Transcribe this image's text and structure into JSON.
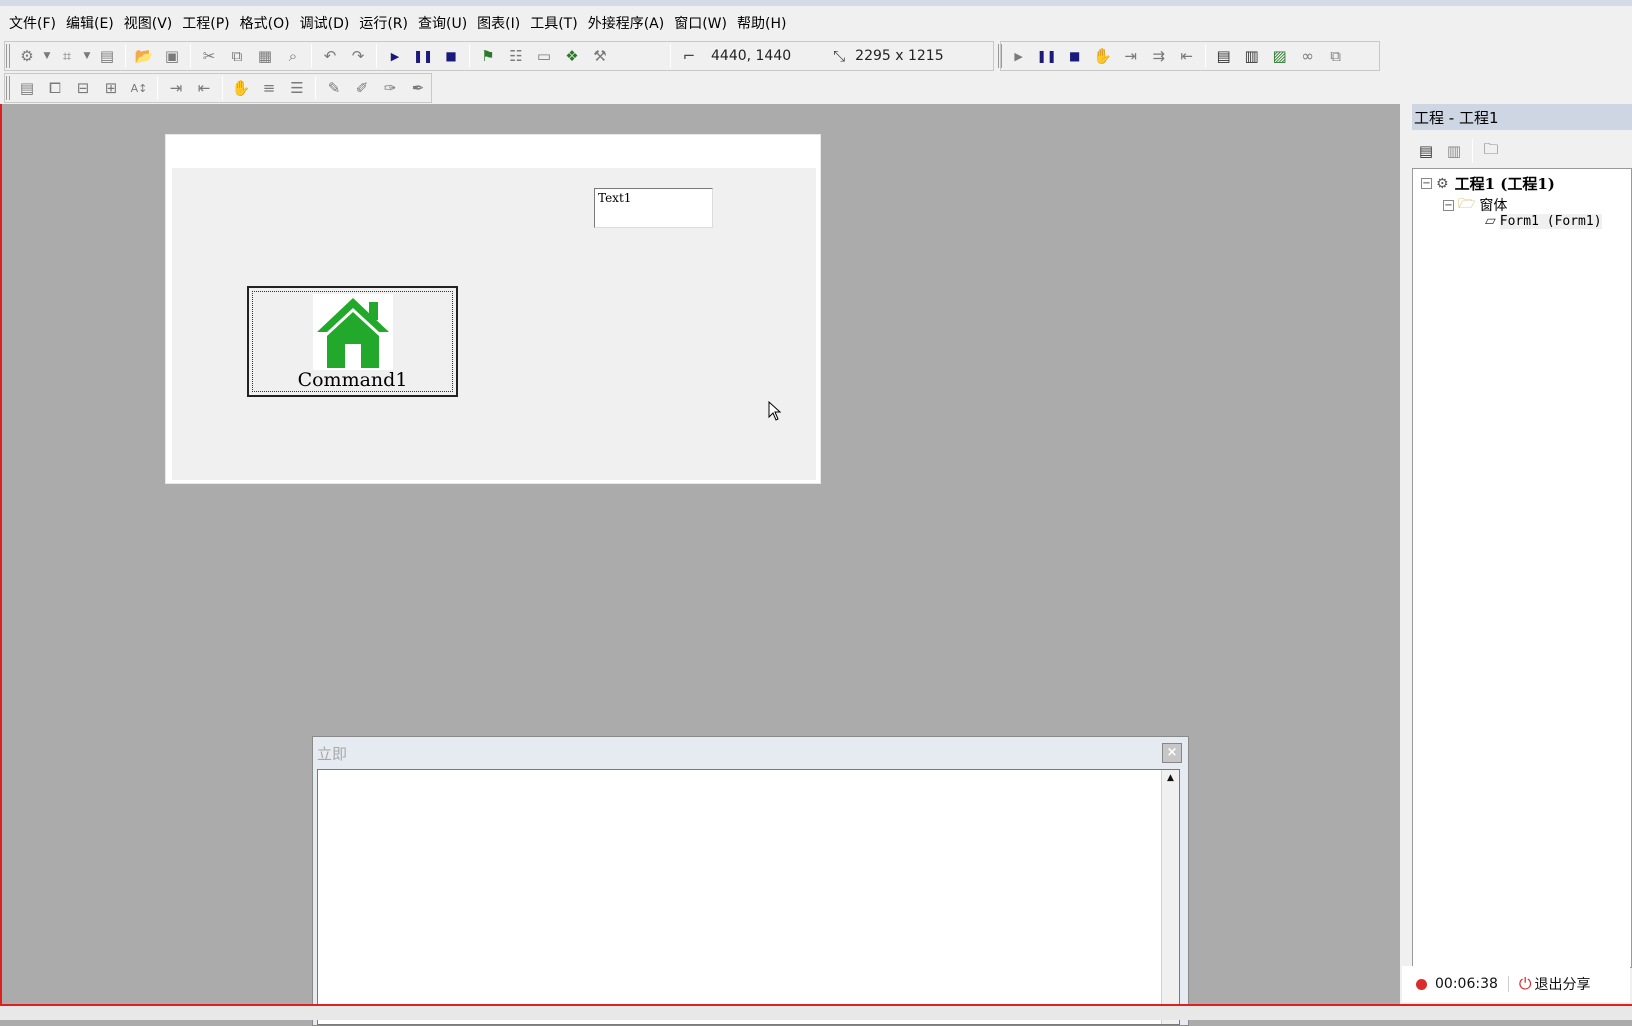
{
  "menu": {
    "items": [
      "文件(F)",
      "编辑(E)",
      "视图(V)",
      "工程(P)",
      "格式(O)",
      "调试(D)",
      "运行(R)",
      "查询(U)",
      "图表(I)",
      "工具(T)",
      "外接程序(A)",
      "窗口(W)",
      "帮助(H)"
    ]
  },
  "toolbar": {
    "position": "4440, 1440",
    "size": "2295 x 1215"
  },
  "form": {
    "textbox_text": "Text1",
    "command_caption": "Command1",
    "command_icon": "home-icon",
    "icon_color": "#22a82a"
  },
  "immediate": {
    "title": "立即",
    "close": "×"
  },
  "project": {
    "title": "工程 - 工程1",
    "tree": {
      "root": "工程1 (工程1)",
      "folder": "窗体",
      "form_item": "Form1 (Form1)"
    }
  },
  "share": {
    "timer": "00:06:38",
    "exit_label": "退出分享"
  }
}
